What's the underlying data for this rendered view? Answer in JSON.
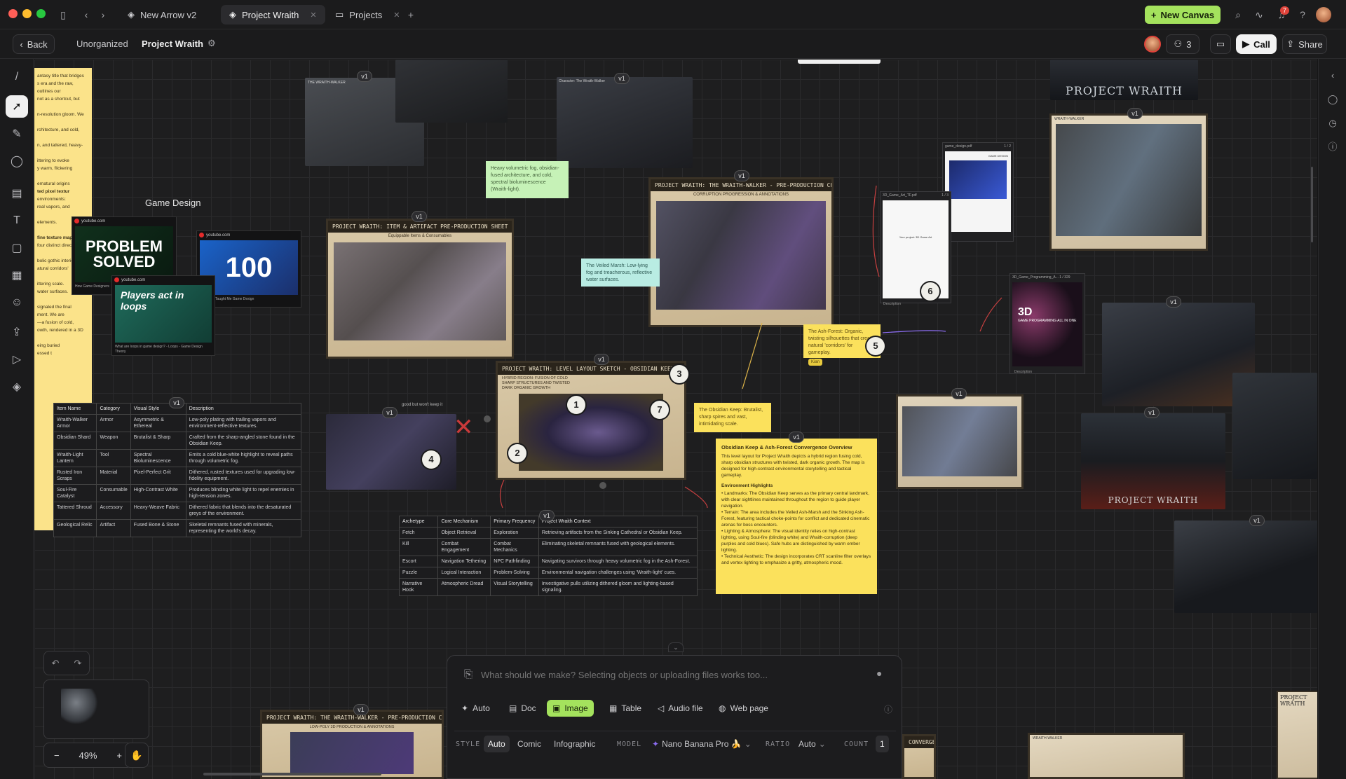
{
  "titlebar": {
    "tabs": [
      {
        "label": "New Arrow v2"
      },
      {
        "label": "Project Wraith"
      },
      {
        "label": "Projects"
      }
    ],
    "new_canvas_label": "New Canvas",
    "notification_count": "7"
  },
  "subbar": {
    "back_label": "Back",
    "breadcrumb_parent": "Unorganized",
    "breadcrumb_current": "Project Wraith",
    "collaborator_count": "3",
    "call_label": "Call",
    "share_label": "Share"
  },
  "canvas": {
    "section_label": "Game Design",
    "doc_lines": [
      "antasy title that bridges",
      "s era and the raw,",
      "outlines our",
      "not as a shortcut, but",
      "",
      "n-resolution gloom. We",
      "",
      "rchitecture, and cold,",
      "",
      "n, and tattered, heavy-",
      "",
      "ittering to evoke",
      "y warm, flickering",
      "",
      "ernatural origins",
      "ted pixel textur",
      "environments:",
      "real vapors, and",
      "",
      "elements.",
      "",
      "fine texture map",
      "four distinct directions",
      "",
      "bolic gothic interiors",
      "atural corridors'",
      "",
      "ittering scale.",
      "water surfaces.",
      "",
      "signaled the final",
      "ment. We are",
      "—a fusion of cold,",
      "owth, rendered in a 3D",
      "",
      "eing buried",
      "essed t"
    ],
    "youtube_cards": [
      {
        "source": "youtube.com",
        "title": "PROBLEM SOLVED",
        "caption": "How Game Designers"
      },
      {
        "source": "youtube.com",
        "title": "100",
        "caption": "mes That Taught Me Game Design"
      },
      {
        "source": "youtube.com",
        "title": "Players act in loops",
        "caption": "What are loops in game design? - Loops - Game Design Theory"
      }
    ],
    "stickies": {
      "fog": "Heavy volumetric fog, obsidian-fused architecture, and cold, spectral bioluminescence (Wraith-light).",
      "marsh": "The Veiled Marsh: Low-lying fog and treacherous, reflective water surfaces.",
      "forest": "The Ash-Forest: Organic, twisting silhouettes that create natural 'corridors' for gameplay.",
      "forest_tag": "Kian",
      "keep": "The Obsidian Keep: Brutalist, sharp spires and vast, intimidating scale.",
      "good_but": "good but won't keep it"
    },
    "sheets": {
      "items": "PROJECT WRAITH: ITEM & ARTIFACT PRE-PRODUCTION SHEET",
      "items_sub": "Equippable Items & Consumables",
      "character": "PROJECT WRAITH: THE WRAITH-WALKER - PRE-PRODUCTION CHARACTER SHEET",
      "character_sub": "CORRUPTION PROGRESSION & ANNOTATIONS",
      "level": "PROJECT WRAITH: LEVEL LAYOUT SKETCH - OBSIDIAN KEEP & ASH-FOREST CONVERGENCE",
      "level_sub": "HYBRID REGION: FUSION OF COLD SHARP STRUCTURES AND TWISTED DARK ORGANIC GROWTH",
      "lowpoly": "PROJECT WRAITH: THE WRAITH-WALKER - PRE-PRODUCTION CHARACTER SHEET",
      "lowpoly_sub": "LOW-POLY 3D PRODUCTION & ANNOTATIONS",
      "walker_small": "THE WRAITH-WALKER",
      "char_small": "Character: The Wraith-Walker",
      "wraith_walker_right": "WRAITH-WALKER",
      "project_wraith": "PROJECT WRAITH",
      "convergence": "CONVERGENCE"
    },
    "files": {
      "pdf": "game_design.pdf",
      "pdf_pages": "1 / 2",
      "game_design": "GAME DESIGN",
      "game_art": "3D_Game_Art_TF.pdf",
      "game_art_pages": "1 / 3",
      "game_art_text": "Your project: 3D Game Art",
      "programming": "3D_Game_Programming_A... 1 / 329",
      "programming_title": "3D",
      "programming_sub": "GAME PROGRAMMING ALL IN ONE",
      "description": "Description"
    },
    "item_table": {
      "headers": [
        "Item Name",
        "Category",
        "Visual Style",
        "Description"
      ],
      "rows": [
        [
          "Wraith-Walker Armor",
          "Armor",
          "Asymmetric & Ethereal",
          "Low-poly plating with trailing vapors and environment-reflective textures."
        ],
        [
          "Obsidian Shard",
          "Weapon",
          "Brutalist & Sharp",
          "Crafted from the sharp-angled stone found in the Obsidian Keep."
        ],
        [
          "Wraith-Light Lantern",
          "Tool",
          "Spectral Bioluminescence",
          "Emits a cold blue-white highlight to reveal paths through volumetric fog."
        ],
        [
          "Rusted Iron Scraps",
          "Material",
          "Pixel-Perfect Grit",
          "Dithered, rusted textures used for upgrading low-fidelity equipment."
        ],
        [
          "Soul-Fire Catalyst",
          "Consumable",
          "High-Contrast White",
          "Produces blinding white light to repel enemies in high-tension zones."
        ],
        [
          "Tattered Shroud",
          "Accessory",
          "Heavy-Weave Fabric",
          "Dithered fabric that blends into the desaturated greys of the environment."
        ],
        [
          "Geological Relic",
          "Artifact",
          "Fused Bone & Stone",
          "Skeletal remnants fused with minerals, representing the world's decay."
        ]
      ]
    },
    "mechanic_table": {
      "headers": [
        "Archetype",
        "Core Mechanism",
        "Primary Frequency",
        "Project Wraith Context"
      ],
      "rows": [
        [
          "Fetch",
          "Object Retrieval",
          "Exploration",
          "Retrieving artifacts from the Sinking Cathedral or Obsidian Keep."
        ],
        [
          "Kill",
          "Combat Engagement",
          "Combat Mechanics",
          "Eliminating skeletal remnants fused with geological elements."
        ],
        [
          "Escort",
          "Navigation Tethering",
          "NPC Pathfinding",
          "Navigating survivors through heavy volumetric fog in the Ash-Forest."
        ],
        [
          "Puzzle",
          "Logical Interaction",
          "Problem-Solving",
          "Environmental navigation challenges using 'Wraith-light' cues."
        ],
        [
          "Narrative Hook",
          "Atmospheric Dread",
          "Visual Storytelling",
          "Investigative pulls utilizing dithered gloom and lighting-based signaling."
        ]
      ]
    },
    "overview": {
      "title": "Obsidian Keep & Ash-Forest Convergence Overview",
      "intro": "This level layout for Project Wraith depicts a hybrid region fusing cold, sharp obsidian structures with twisted, dark organic growth. The map is designed for high-contrast environmental storytelling and tactical gameplay.",
      "highlights_title": "Environment Highlights",
      "bullets": [
        "Landmarks: The Obsidian Keep serves as the primary central landmark, with clear sightlines maintained throughout the region to guide player navigation.",
        "Terrain: The area includes the Veiled Ash-Marsh and the Sinking Ash-Forest, featuring tactical choke-points for conflict and dedicated cinematic arenas for boss encounters.",
        "Lighting & Atmosphere: The visual identity relies on high-contrast lighting, using Soul-fire (blinding white) and Wraith-corruption (deep purples and cold blues). Safe hubs are distinguished by warm ember lighting.",
        "Technical Aesthetic: The design incorporates CRT scanline filter overlays and vertex lighting to emphasize a gritty, atmospheric mood."
      ]
    },
    "version_tag": "v1",
    "numbers": [
      "1",
      "2",
      "3",
      "4",
      "5",
      "6",
      "7"
    ]
  },
  "composer": {
    "placeholder": "What should we make? Selecting objects or uploading files works too...",
    "types": [
      "Auto",
      "Doc",
      "Image",
      "Table",
      "Audio file",
      "Web page"
    ],
    "style_label": "STYLE",
    "styles": [
      "Auto",
      "Comic",
      "Infographic"
    ],
    "model_label": "MODEL",
    "model_value": "Nano Banana Pro 🍌",
    "ratio_label": "RATIO",
    "ratio_value": "Auto",
    "count_label": "COUNT",
    "count_value": "1"
  },
  "zoom": {
    "level": "49%"
  },
  "colors": {
    "accent": "#a4e25d",
    "canvas": "#1e1e1f",
    "sticky_yellow": "#fbe15c"
  }
}
